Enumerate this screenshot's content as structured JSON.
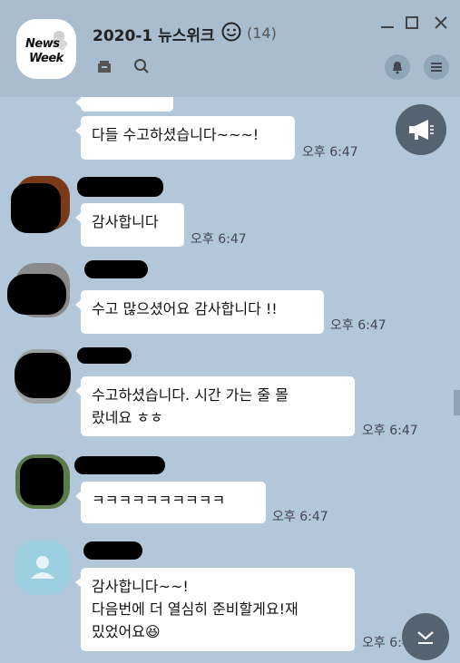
{
  "header": {
    "logo_line1": "News",
    "logo_line2": "Week",
    "title": "2020-1 뉴스위크",
    "emoji": "☺",
    "member_count": "(14)",
    "icons": [
      "drawer-icon",
      "search-icon",
      "bell-icon",
      "menu-icon",
      "minimize-icon",
      "maximize-icon",
      "close-icon"
    ]
  },
  "messages": [
    {
      "text": "다들 수고하셨습니다~~~!",
      "time": "오후 6:47"
    },
    {
      "text": "감사합니다",
      "time": "오후 6:47"
    },
    {
      "text": "수고 많으셨어요 감사합니다 !!",
      "time": "오후 6:47"
    },
    {
      "text_line1": "수고하셨습니다. 시간 가는 줄 몰",
      "text_line2": "랐네요 ㅎㅎ",
      "time": "오후 6:47"
    },
    {
      "text": "ㅋㅋㅋㅋㅋㅋㅋㅋㅋㅋ",
      "time": "오후 6:47"
    },
    {
      "text_line1": "감사합니다~~!",
      "text_line2": "다음번에 더 열심히 준비할게요!재",
      "text_line3": "밌었어요",
      "emoji": "😆",
      "time": "오후 6:47"
    }
  ],
  "colors": {
    "background": "#b2c7d9",
    "header": "#a9bdce",
    "bubble": "#ffffff"
  }
}
